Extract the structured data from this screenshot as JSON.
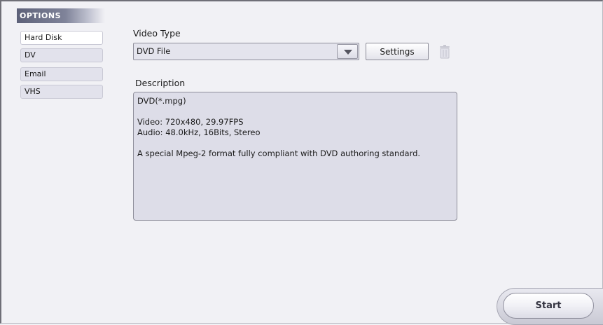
{
  "sidebar": {
    "header": "OPTIONS",
    "items": [
      {
        "label": "Hard Disk",
        "selected": true
      },
      {
        "label": "DV",
        "selected": false
      },
      {
        "label": "Email",
        "selected": false
      },
      {
        "label": "VHS",
        "selected": false
      }
    ]
  },
  "video_type": {
    "label": "Video Type",
    "value": "DVD File"
  },
  "toolbar": {
    "settings_label": "Settings",
    "trash_icon": "trash-icon"
  },
  "description": {
    "label": "Description",
    "lines": [
      "DVD(*.mpg)",
      "",
      "Video: 720x480, 29.97FPS",
      "Audio: 48.0kHz, 16Bits, Stereo",
      "",
      "A special Mpeg-2 format fully compliant with DVD authoring standard."
    ]
  },
  "start_button": {
    "label": "Start"
  },
  "colors": {
    "background": "#f1f1f5",
    "header_gradient_start": "#5d6179",
    "field_background": "#dddde8"
  }
}
